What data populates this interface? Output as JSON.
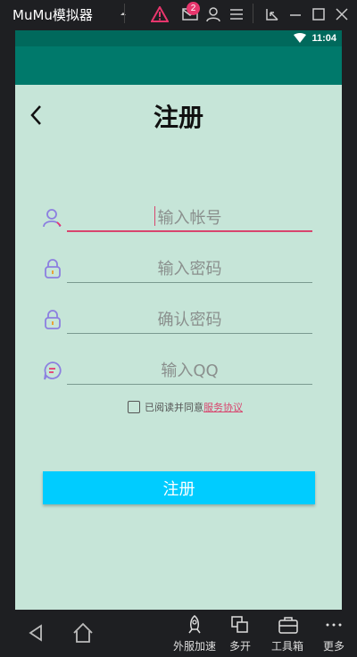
{
  "emulator": {
    "title": "MuMu模拟器",
    "badge_count": "2",
    "bottom_tools": [
      {
        "label": "外服加速",
        "icon": "rocket-icon"
      },
      {
        "label": "多开",
        "icon": "multi-window-icon"
      },
      {
        "label": "工具箱",
        "icon": "toolbox-icon"
      },
      {
        "label": "更多",
        "icon": "more-icon"
      }
    ]
  },
  "statusbar": {
    "time": "11:04"
  },
  "page": {
    "title": "注册",
    "fields": [
      {
        "placeholder": "输入帐号",
        "icon": "user-icon"
      },
      {
        "placeholder": "输入密码",
        "icon": "lock-icon"
      },
      {
        "placeholder": "确认密码",
        "icon": "lock-icon"
      },
      {
        "placeholder": "输入QQ",
        "icon": "chat-icon"
      }
    ],
    "agree_text": "已阅读并同意",
    "agree_link": "服务协议",
    "submit_label": "注册"
  },
  "colors": {
    "statusbar": "#00695c",
    "appbar": "#00796b",
    "page_bg": "#c6e5d8",
    "accent": "#d8456e",
    "button": "#00ccff"
  }
}
